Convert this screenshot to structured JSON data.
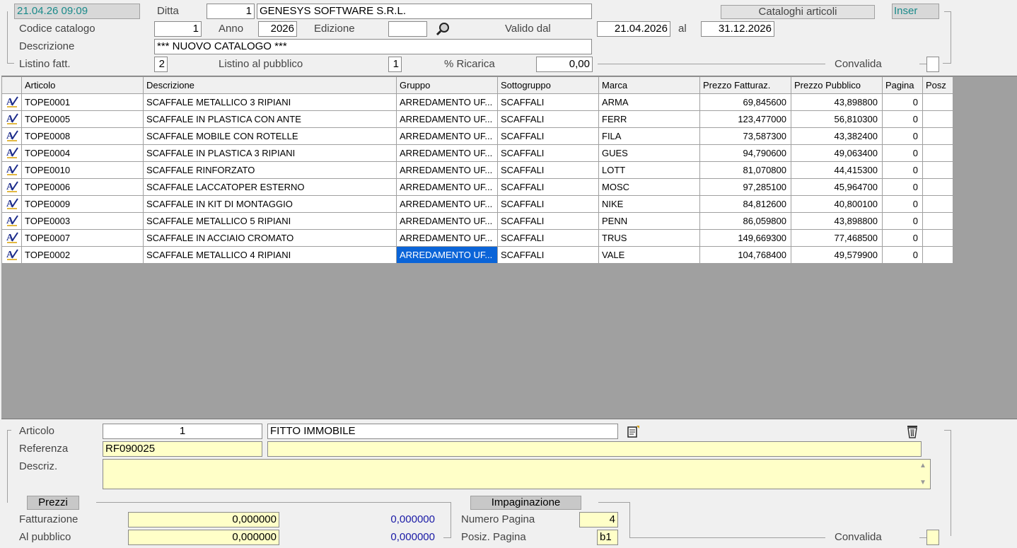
{
  "header": {
    "datetime": "21.04.26 09:09",
    "ditta_label": "Ditta",
    "ditta_code": "1",
    "ditta_name": "GENESYS SOFTWARE S.R.L.",
    "window_title": "Cataloghi articoli",
    "mode": "Inser"
  },
  "catalog": {
    "codice_label": "Codice catalogo",
    "codice_value": "1",
    "anno_label": "Anno",
    "anno_value": "2026",
    "edizione_label": "Edizione",
    "edizione_value": "",
    "valido_label": "Valido dal",
    "valido_dal": "21.04.2026",
    "al_label": "al",
    "valido_al": "31.12.2026",
    "descrizione_label": "Descrizione",
    "descrizione_value": "*** NUOVO CATALOGO ***",
    "listino_fatt_label": "Listino fatt.",
    "listino_fatt_value": "2",
    "listino_pub_label": "Listino al pubblico",
    "listino_pub_value": "1",
    "ricarica_label": "% Ricarica",
    "ricarica_value": "0,00",
    "convalida_label": "Convalida"
  },
  "grid": {
    "columns": [
      "Articolo",
      "Descrizione",
      "Gruppo",
      "Sottogruppo",
      "Marca",
      "Prezzo Fatturaz.",
      "Prezzo Pubblico",
      "Pagina",
      "Posz"
    ],
    "rows": [
      [
        "TOPE0001",
        "SCAFFALE METALLICO 3 RIPIANI",
        "ARREDAMENTO UF...",
        "SCAFFALI",
        "ARMA",
        "69,845600",
        "43,898800",
        "0",
        ""
      ],
      [
        "TOPE0005",
        "SCAFFALE IN PLASTICA CON ANTE",
        "ARREDAMENTO UF...",
        "SCAFFALI",
        "FERR",
        "123,477000",
        "56,810300",
        "0",
        ""
      ],
      [
        "TOPE0008",
        "SCAFFALE MOBILE CON ROTELLE",
        "ARREDAMENTO UF...",
        "SCAFFALI",
        "FILA",
        "73,587300",
        "43,382400",
        "0",
        ""
      ],
      [
        "TOPE0004",
        "SCAFFALE IN PLASTICA 3 RIPIANI",
        "ARREDAMENTO UF...",
        "SCAFFALI",
        "GUES",
        "94,790600",
        "49,063400",
        "0",
        ""
      ],
      [
        "TOPE0010",
        "SCAFFALE RINFORZATO",
        "ARREDAMENTO UF...",
        "SCAFFALI",
        "LOTT",
        "81,070800",
        "44,415300",
        "0",
        ""
      ],
      [
        "TOPE0006",
        "SCAFFALE LACCATOPER ESTERNO",
        "ARREDAMENTO UF...",
        "SCAFFALI",
        "MOSC",
        "97,285100",
        "45,964700",
        "0",
        ""
      ],
      [
        "TOPE0009",
        "SCAFFALE IN KIT DI MONTAGGIO",
        "ARREDAMENTO UF...",
        "SCAFFALI",
        "NIKE",
        "84,812600",
        "40,800100",
        "0",
        ""
      ],
      [
        "TOPE0003",
        "SCAFFALE METALLICO 5 RIPIANI",
        "ARREDAMENTO UF...",
        "SCAFFALI",
        "PENN",
        "86,059800",
        "43,898800",
        "0",
        ""
      ],
      [
        "TOPE0007",
        "SCAFFALE IN ACCIAIO CROMATO",
        "ARREDAMENTO UF...",
        "SCAFFALI",
        "TRUS",
        "149,669300",
        "77,468500",
        "0",
        ""
      ],
      [
        "TOPE0002",
        "SCAFFALE METALLICO 4 RIPIANI",
        "ARREDAMENTO UF...",
        "SCAFFALI",
        "VALE",
        "104,768400",
        "49,579900",
        "0",
        ""
      ]
    ],
    "selected_row": 9,
    "selected_col": 2
  },
  "detail": {
    "articolo_label": "Articolo",
    "articolo_code": "1",
    "articolo_desc": "FITTO IMMOBILE",
    "referenza_label": "Referenza",
    "referenza_value": "RF090025",
    "referenza_extra": "",
    "descriz_label": "Descriz.",
    "descriz_value": "",
    "prezzi_tag": "Prezzi",
    "fatturazione_label": "Fatturazione",
    "fatturazione_value": "0,000000",
    "fatturazione_calc": "0,000000",
    "pubblico_label": "Al pubblico",
    "pubblico_value": "0,000000",
    "pubblico_calc": "0,000000",
    "impaginazione_tag": "Impaginazione",
    "numero_pagina_label": "Numero Pagina",
    "numero_pagina_value": "4",
    "posiz_pagina_label": "Posiz. Pagina",
    "posiz_pagina_value": "b1",
    "convalida_label": "Convalida"
  },
  "colors": {
    "selection": "#0a64d8",
    "required_field": "#ffffc8",
    "grid_bg": "#a0a0a0",
    "accent_text": "#1a8a8a",
    "calc_text": "#1a1aa6"
  }
}
